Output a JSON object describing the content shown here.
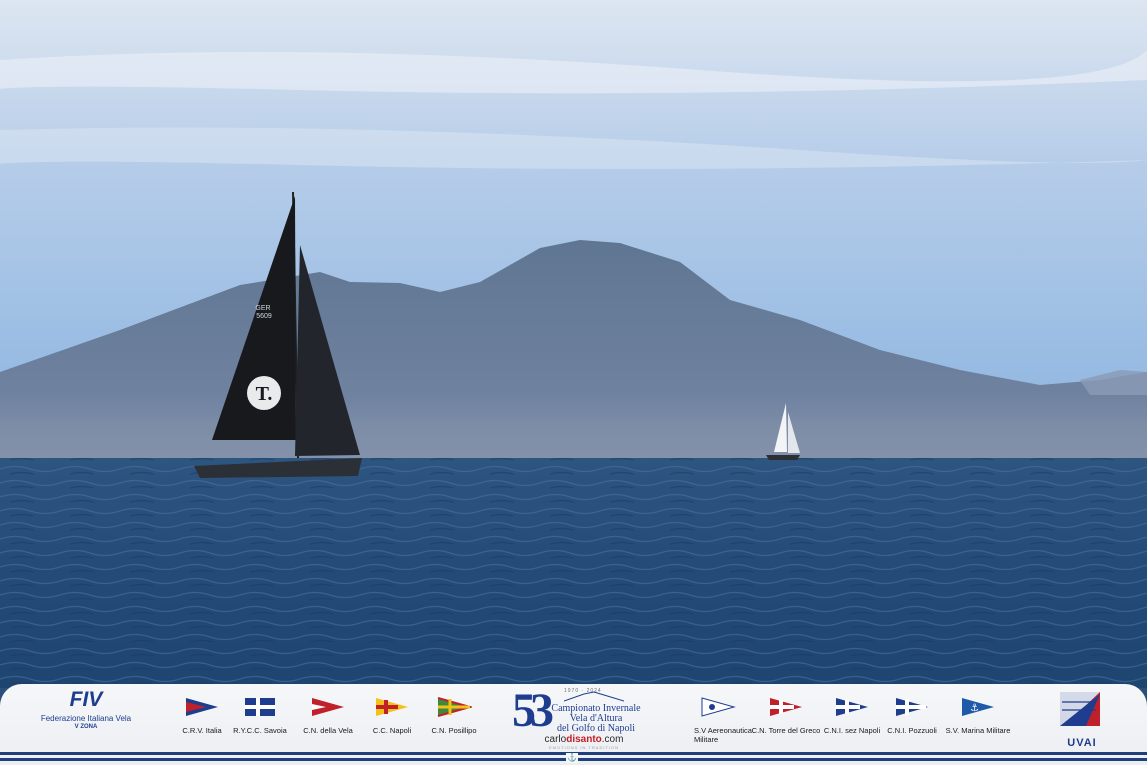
{
  "photo": {
    "subject": "sailboats-with-volcano",
    "sail_number": "GER 5609",
    "sail_logo": "T.",
    "colors": {
      "sky_top": "#dfe7f1",
      "sky_bottom": "#8fb6e2",
      "mountain": "#5d7390",
      "sea": "#2c5481"
    }
  },
  "footer": {
    "fiv": {
      "logo": "FIV",
      "name": "Federazione Italiana Vela",
      "zone": "V ZONA"
    },
    "clubs_left": [
      {
        "label": "C.R.V. Italia",
        "icon": "burgee-red-blue-flag"
      },
      {
        "label": "R.Y.C.C. Savoia",
        "icon": "blue-white-cross-flag"
      },
      {
        "label": "C.N. della Vela",
        "icon": "red-white-pennant-flag"
      },
      {
        "label": "C.C. Napoli",
        "icon": "yellow-red-flag"
      },
      {
        "label": "C.N. Posillipo",
        "icon": "green-union-jack-flag"
      }
    ],
    "event": {
      "number": "53",
      "years": "1970 · 2024",
      "line1": "Campionato Invernale",
      "line2": "Vela d'Altura",
      "line3": "del Golfo di Napoli",
      "sponsor_pre": "carlo",
      "sponsor_bold": "disanto",
      "sponsor_post": ".com",
      "tagline": "EMOTIONS IN TRADITION"
    },
    "clubs_right": [
      {
        "label": "S.V Aereonautica Militare",
        "icon": "white-pennant-flag"
      },
      {
        "label": "C.N. Torre del Greco",
        "icon": "red-white-cross-flag"
      },
      {
        "label": "C.N.I. sez Napoli",
        "icon": "blue-white-flag"
      },
      {
        "label": "C.N.I. Pozzuoli",
        "icon": "blue-white-burgee-flag"
      },
      {
        "label": "S.V. Marina Militare",
        "icon": "blue-anchor-flag"
      }
    ],
    "uvai": {
      "logo": "UVAI"
    }
  }
}
